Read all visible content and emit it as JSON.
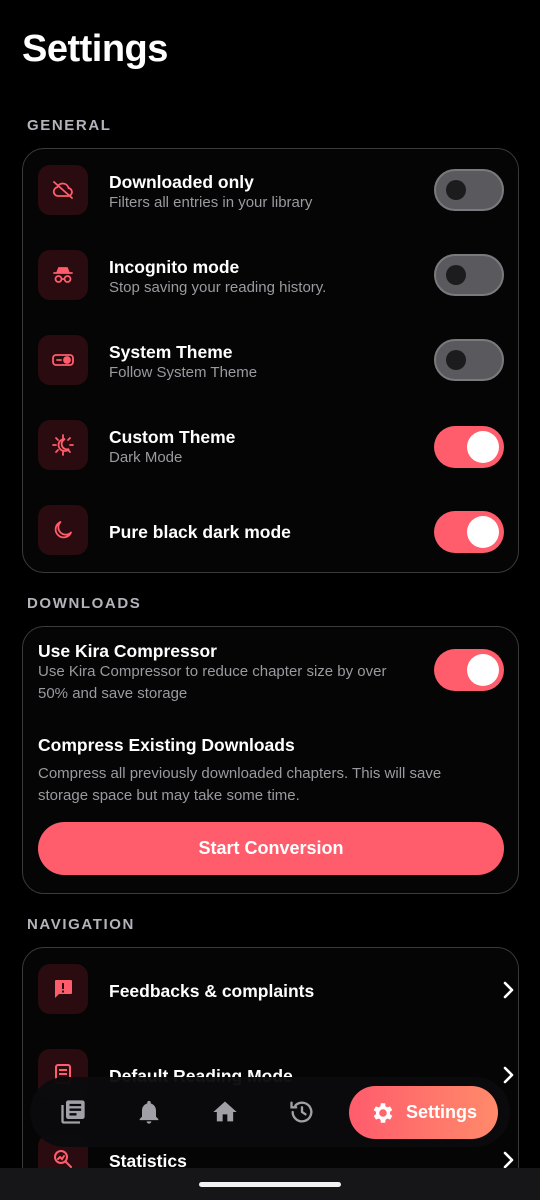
{
  "header": {
    "title": "Settings"
  },
  "general": {
    "label": "GENERAL",
    "items": [
      {
        "title": "Downloaded only",
        "subtitle": "Filters all entries in your library",
        "icon": "cloud-off-icon",
        "enabled": false
      },
      {
        "title": "Incognito mode",
        "subtitle": "Stop saving your reading history.",
        "icon": "incognito-icon",
        "enabled": false
      },
      {
        "title": "System Theme",
        "subtitle": "Follow System Theme",
        "icon": "theme-toggle-icon",
        "enabled": false
      },
      {
        "title": "Custom Theme",
        "subtitle": "Dark Mode",
        "icon": "sun-moon-icon",
        "enabled": true
      },
      {
        "title": "Pure black dark mode",
        "subtitle": "",
        "icon": "moon-icon",
        "enabled": true
      }
    ]
  },
  "downloads": {
    "label": "DOWNLOADS",
    "compressor": {
      "title": "Use Kira Compressor",
      "subtitle_line1": "Use Kira Compressor to reduce chapter size by over",
      "subtitle_line2": "50% and save storage",
      "enabled": true
    },
    "compress_existing": {
      "title": "Compress Existing Downloads",
      "subtitle_line1": "Compress all previously downloaded chapters. This will save",
      "subtitle_line2": "storage space but may take some time."
    },
    "start_button": "Start Conversion"
  },
  "navigation": {
    "label": "NAVIGATION",
    "items": [
      {
        "title": "Feedbacks & complaints",
        "icon": "feedback-icon"
      },
      {
        "title": "Default Reading Mode",
        "icon": "reader-icon"
      },
      {
        "title": "Statistics",
        "icon": "statistics-icon"
      }
    ]
  },
  "bottom_nav": {
    "items": [
      {
        "name": "library",
        "icon": "library-icon"
      },
      {
        "name": "updates",
        "icon": "bell-icon"
      },
      {
        "name": "home",
        "icon": "home-icon"
      },
      {
        "name": "history",
        "icon": "history-icon"
      }
    ],
    "active_label": "Settings",
    "active_icon": "gear-icon"
  },
  "colors": {
    "accent": "#ff5c6c",
    "accent_end": "#ff8a6a",
    "icon_bg": "#2a0b0f",
    "background": "#000000"
  }
}
